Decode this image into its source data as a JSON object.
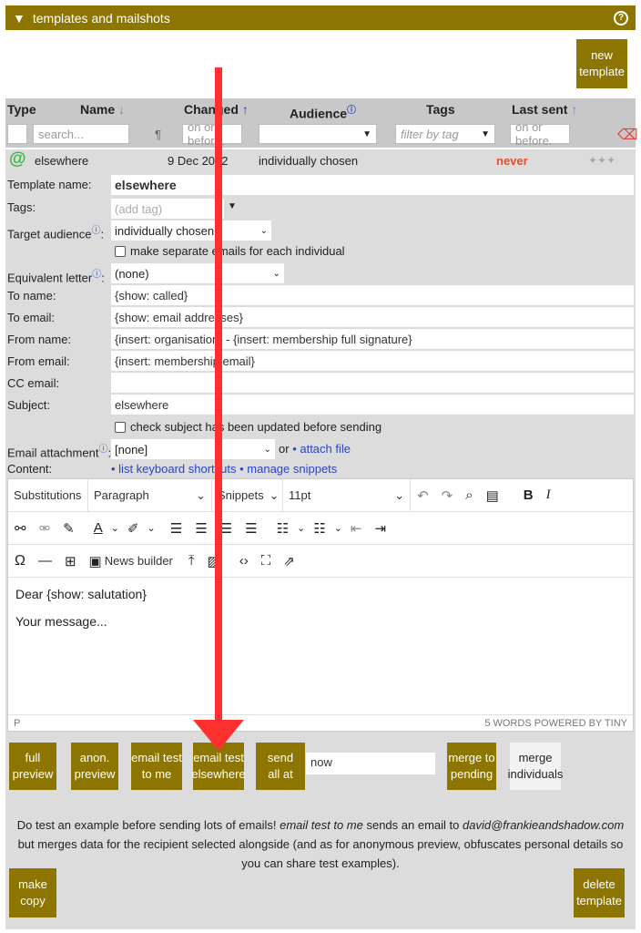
{
  "header": {
    "title": "templates and mailshots",
    "toggle_glyph": "▼",
    "help_glyph": "?"
  },
  "buttons": {
    "new_template": "new\ntemplate",
    "full_preview": "full\npreview",
    "anon_preview": "anon.\npreview",
    "email_test_me": "email test\nto me",
    "email_test_elsewhere": "email test\nelsewhere",
    "send_all_at": "send\nall at",
    "merge_to_pending": "merge to\npending",
    "merge_individuals": "merge\nindividuals",
    "make_copy": "make\ncopy",
    "delete_template": "delete\ntemplate"
  },
  "table": {
    "columns": {
      "type": "Type",
      "name": "Name",
      "changed": "Changed",
      "audience": "Audience",
      "tags": "Tags",
      "last_sent": "Last sent"
    },
    "sort_arrows": {
      "name": "↓",
      "changed": "↑",
      "last_sent": "↑"
    },
    "filters": {
      "search_placeholder": "search...",
      "pilcrow": "¶",
      "changed_placeholder": "on or before.",
      "tags_placeholder": "filter by tag",
      "last_sent_placeholder": "on or before."
    }
  },
  "record": {
    "name": "elsewhere",
    "changed": "9 Dec 2022",
    "audience": "individually chosen",
    "last_sent": "never"
  },
  "form": {
    "template_name": {
      "label": "Template name:",
      "value": "elsewhere"
    },
    "tags": {
      "label": "Tags:",
      "placeholder": "(add tag)"
    },
    "target_audience": {
      "label": "Target audience",
      "value": "individually chosen"
    },
    "separate_emails": "make separate emails for each individual",
    "equivalent_letter": {
      "label": "Equivalent letter",
      "value": "(none)"
    },
    "to_name": {
      "label": "To name:",
      "value": "{show: called}"
    },
    "to_email": {
      "label": "To email:",
      "value": "{show: email addresses}"
    },
    "from_name": {
      "label": "From name:",
      "value": "{insert: organisation} - {insert: membership full signature}"
    },
    "from_email": {
      "label": "From email:",
      "value": "{insert: membership email}"
    },
    "cc_email": {
      "label": "CC email:",
      "value": ""
    },
    "subject": {
      "label": "Subject:",
      "value": "elsewhere"
    },
    "check_subject": "check subject has been updated before sending",
    "email_attachment": {
      "label": "Email attachment",
      "value": "[none]",
      "or": "or",
      "attach_link": "• attach file"
    },
    "content": {
      "label": "Content:",
      "shortcuts_link": "• list keyboard shortcuts",
      "snippets_link": "• manage snippets"
    }
  },
  "editor": {
    "toolbar": {
      "substitutions": "Substitutions",
      "paragraph": "Paragraph",
      "snippets": "Snippets",
      "font_size": "11pt",
      "news_builder": "News builder"
    },
    "content": [
      "Dear {show: salutation}",
      "Your message..."
    ],
    "status_left": "P",
    "status_right": "5 WORDS  POWERED BY TINY"
  },
  "send_at_value": "now",
  "help": {
    "part1": "Do test an example before sending lots of emails! ",
    "em1": "email test to me",
    "part2": " sends an email to ",
    "em2": "david@frankieandshadow.com",
    "part3": " but merges data for the recipient selected alongside (and as for anonymous preview, obfuscates personal details so you can share test examples)."
  }
}
